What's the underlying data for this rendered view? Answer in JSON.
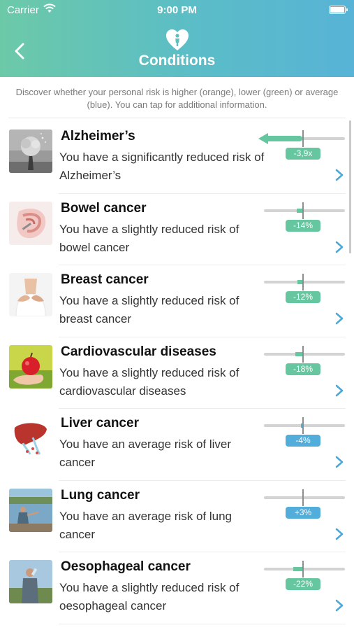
{
  "status_bar": {
    "carrier": "Carrier",
    "time": "9:00 PM"
  },
  "header": {
    "title": "Conditions",
    "icon": "heart-person-icon"
  },
  "intro": "Discover whether your personal risk is higher (orange), lower (green) or average (blue). You can tap for additional information.",
  "colors": {
    "lower": "#65c6a0",
    "average": "#52addb",
    "higher": "orange"
  },
  "conditions": [
    {
      "title": "Alzheimer’s",
      "description": "You have a significantly reduced risk of Alzheimer’s",
      "badge": "-3,9x",
      "level": "lower",
      "fraction": -0.95,
      "image": "tree-head-image"
    },
    {
      "title": "Bowel cancer",
      "description": "You have a slightly reduced risk of bowel cancer",
      "badge": "-14%",
      "level": "lower",
      "fraction": -0.14,
      "image": "bowel-anatomy-image"
    },
    {
      "title": "Breast cancer",
      "description": "You have a slightly reduced risk of breast cancer",
      "badge": "-12%",
      "level": "lower",
      "fraction": -0.12,
      "image": "hands-on-chest-image"
    },
    {
      "title": "Cardiovascular diseases",
      "description": "You have a slightly reduced risk of cardiovascular diseases",
      "badge": "-18%",
      "level": "lower",
      "fraction": -0.18,
      "image": "apple-in-hand-image"
    },
    {
      "title": "Liver cancer",
      "description": "You have an average risk of liver cancer",
      "badge": "-4%",
      "level": "average",
      "fraction": -0.04,
      "image": "liver-illustration-image"
    },
    {
      "title": "Lung cancer",
      "description": "You have an average risk of lung cancer",
      "badge": "+3%",
      "level": "average",
      "fraction": 0.03,
      "image": "person-by-lake-image"
    },
    {
      "title": "Oesophageal cancer",
      "description": "You have a slightly reduced risk of oesophageal cancer",
      "badge": "-22%",
      "level": "lower",
      "fraction": -0.22,
      "image": "man-drinking-image"
    }
  ]
}
